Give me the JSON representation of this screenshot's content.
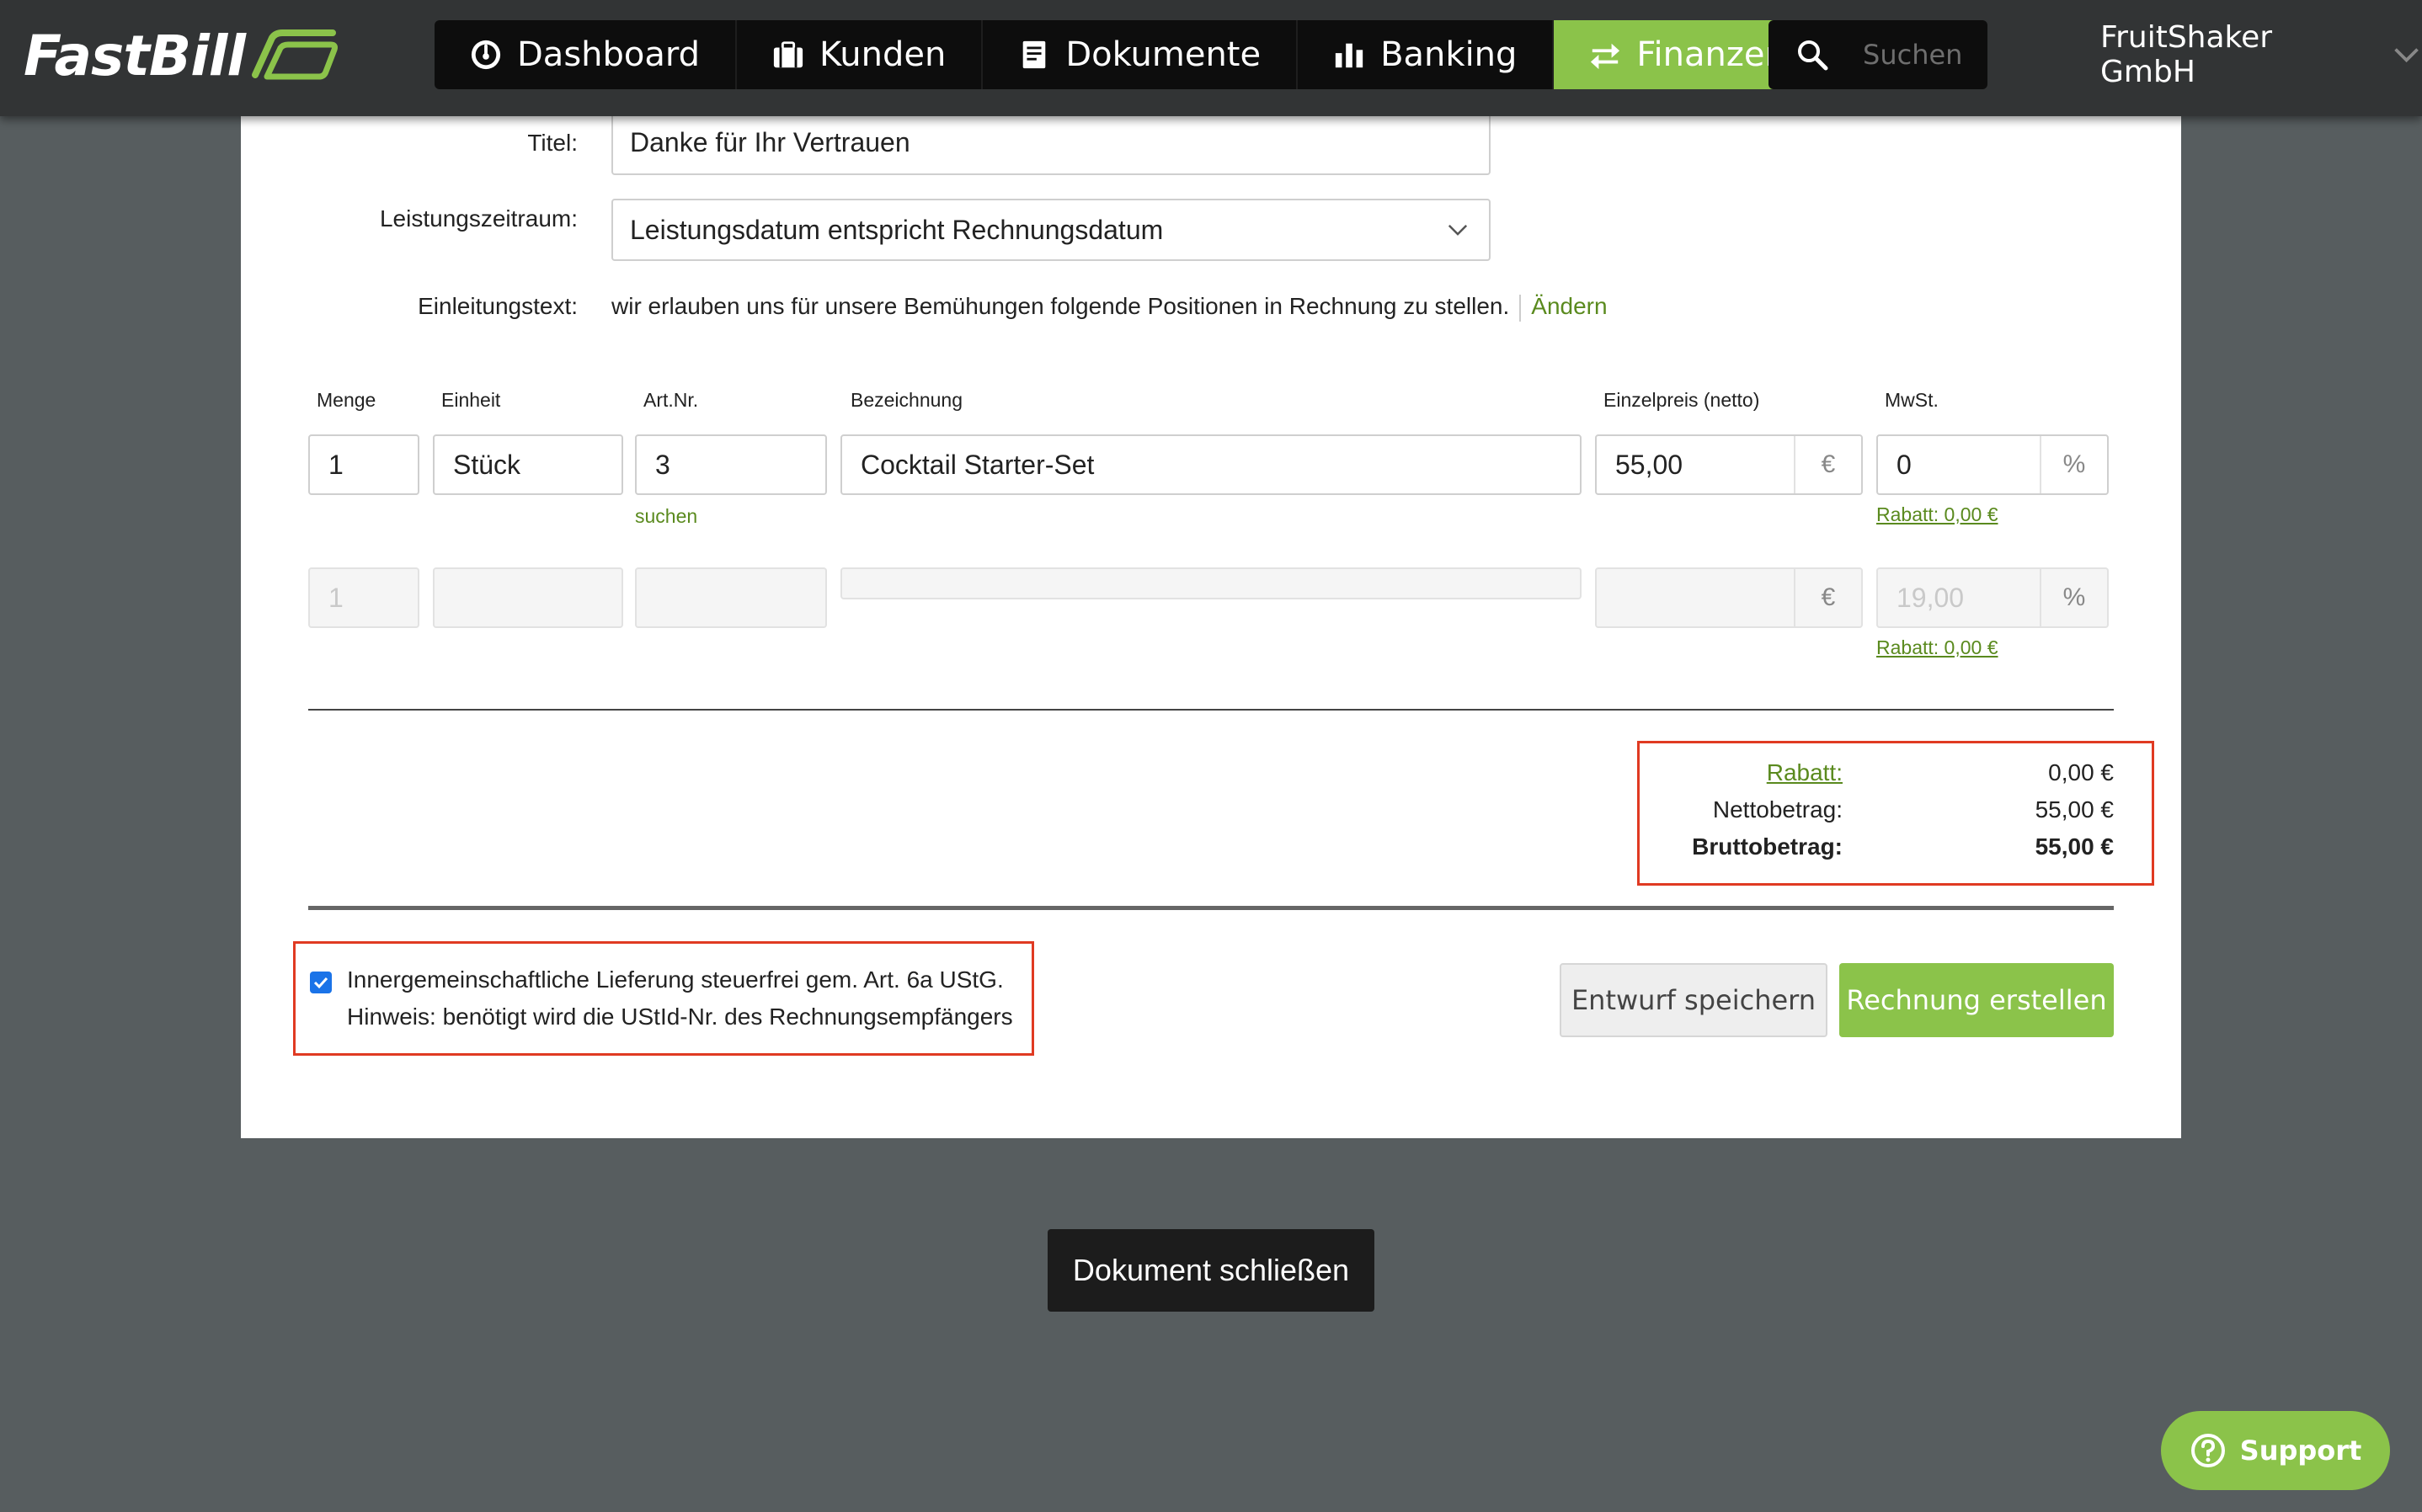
{
  "app": {
    "logo_text": "FastBill",
    "colors": {
      "accent": "#8bc34a",
      "nav_bg": "#0d0d0d",
      "highlight": "#e03a22",
      "background": "#575d5f"
    }
  },
  "nav": {
    "items": [
      {
        "label": "Dashboard",
        "icon": "speedometer-icon"
      },
      {
        "label": "Kunden",
        "icon": "briefcase-icon"
      },
      {
        "label": "Dokumente",
        "icon": "document-icon"
      },
      {
        "label": "Banking",
        "icon": "bar-chart-icon"
      },
      {
        "label": "Finanzen",
        "icon": "transfer-arrows-icon",
        "active": true
      }
    ],
    "search_placeholder": "Suchen",
    "account_name": "FruitShaker GmbH"
  },
  "form": {
    "title_label": "Titel:",
    "title_value": "Danke für Ihr Vertrauen",
    "period_label": "Leistungszeitraum:",
    "period_value": "Leistungsdatum entspricht Rechnungsdatum",
    "intro_label": "Einleitungstext:",
    "intro_value": "wir erlauben uns für unsere Bemühungen folgende Positionen in Rechnung zu stellen.",
    "intro_change": "Ändern"
  },
  "table": {
    "headers": {
      "menge": "Menge",
      "einheit": "Einheit",
      "artnr": "Art.Nr.",
      "bezeichnung": "Bezeichnung",
      "einzelpreis": "Einzelpreis (netto)",
      "mwst": "MwSt."
    },
    "row1": {
      "menge": "1",
      "einheit": "Stück",
      "artnr": "3",
      "bezeichnung": "Cocktail Starter-Set",
      "preis": "55,00",
      "currency": "€",
      "mwst": "0",
      "percent": "%",
      "search_link": "suchen",
      "rabatt_link": "Rabatt: 0,00 €"
    },
    "row2": {
      "menge_placeholder": "1",
      "mwst_placeholder": "19,00",
      "currency": "€",
      "percent": "%",
      "rabatt_link": "Rabatt: 0,00 €"
    }
  },
  "totals": {
    "rabatt_label": "Rabatt:",
    "rabatt_value": "0,00 €",
    "netto_label": "Nettobetrag:",
    "netto_value": "55,00 €",
    "brutto_label": "Bruttobetrag:",
    "brutto_value": "55,00 €"
  },
  "vat": {
    "checked": true,
    "line1": "Innergemeinschaftliche Lieferung steuerfrei gem. Art. 6a UStG.",
    "line2": "Hinweis: benötigt wird die UStId-Nr. des Rechnungsempfängers"
  },
  "actions": {
    "draft": "Entwurf speichern",
    "create": "Rechnung erstellen",
    "close": "Dokument schließen",
    "support": "Support"
  }
}
